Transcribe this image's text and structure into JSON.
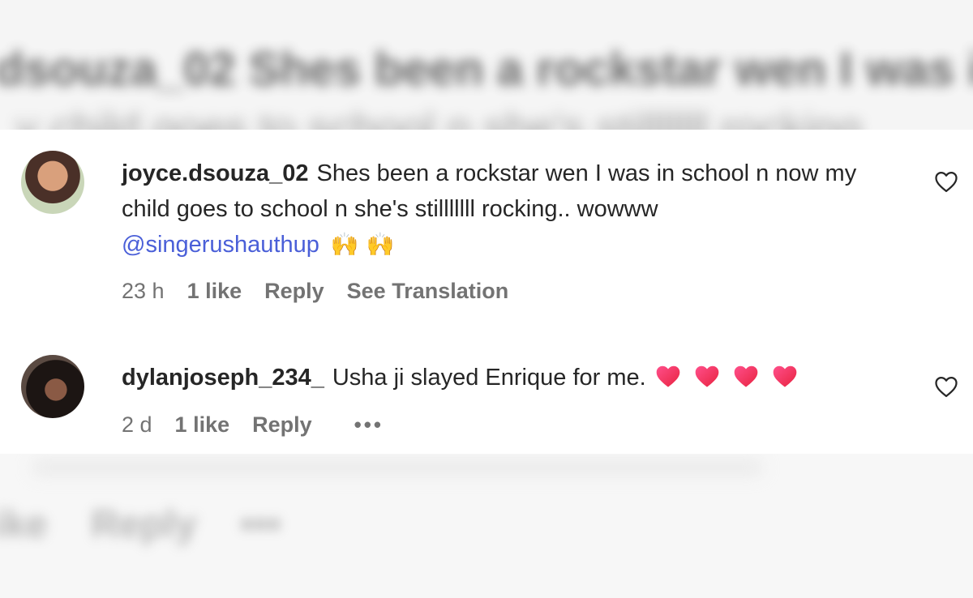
{
  "background": {
    "top_blurred_text": "dsouza_02 Shes been a rockstar wen I was in s",
    "top_blurred_text_2": "y child goes to school n she's stilllllll rocking",
    "bottom_blurred_text": "ike Reply •••"
  },
  "comments": [
    {
      "username": "joyce.dsouza_02",
      "text": "Shes been a rockstar wen I was in school n now my child goes to school n she's stilllllll rocking.. wowww",
      "mention": "@singerushauthup",
      "emoji": "🙌 🙌",
      "time": "23 h",
      "likes": "1 like",
      "reply_label": "Reply",
      "translate_label": "See Translation"
    },
    {
      "username": "dylanjoseph_234_",
      "text": "Usha ji slayed Enrique for me.",
      "emoji_count": 4,
      "time": "2 d",
      "likes": "1 like",
      "reply_label": "Reply",
      "more_label": "•••"
    }
  ],
  "colors": {
    "mention": "#4a5fd8",
    "meta_text": "#737373",
    "heart": "#f0386b"
  }
}
